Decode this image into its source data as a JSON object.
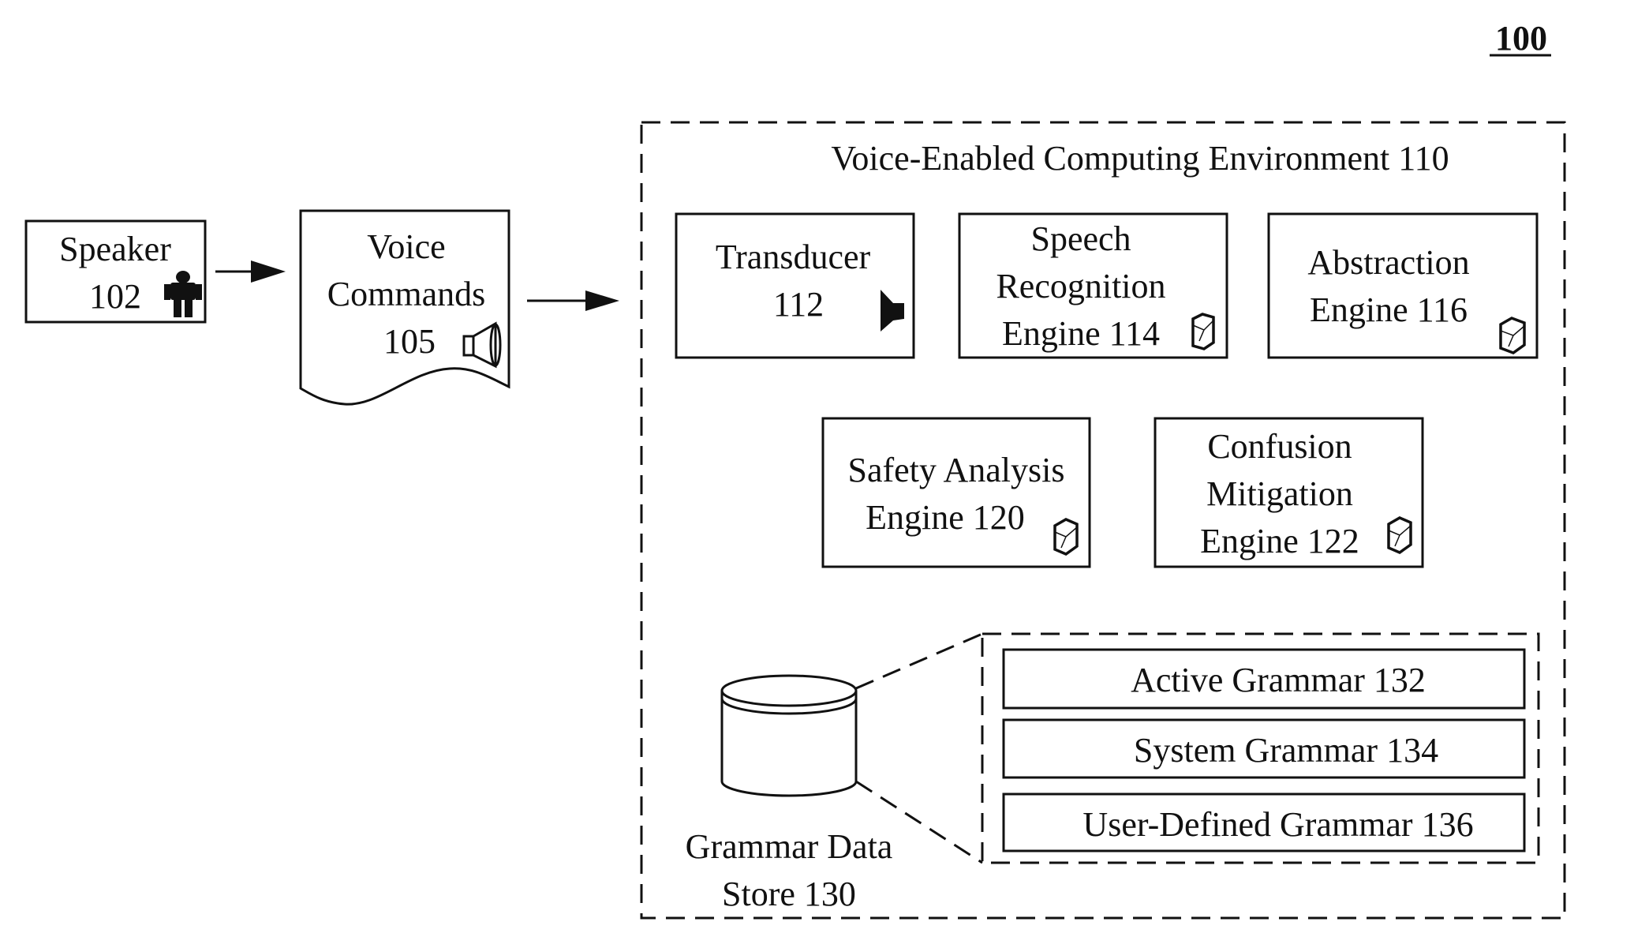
{
  "figure": {
    "number": "100",
    "environment_title": "Voice-Enabled Computing Environment 110"
  },
  "external": {
    "speaker": {
      "lines": [
        "Speaker",
        "102"
      ],
      "icon": "person-icon"
    },
    "voice_commands": {
      "lines": [
        "Voice",
        "Commands",
        "105"
      ],
      "icon": "loudspeaker-icon"
    }
  },
  "components": {
    "transducer": {
      "lines": [
        "Transducer",
        "112"
      ],
      "icon": "speaker-filled-icon"
    },
    "speech_recognition": {
      "lines": [
        "Speech",
        "Recognition",
        "Engine 114"
      ],
      "icon": "engine-cube-icon"
    },
    "abstraction": {
      "lines": [
        "Abstraction",
        "Engine 116"
      ],
      "icon": "engine-cube-icon"
    },
    "safety_analysis": {
      "lines": [
        "Safety Analysis",
        "Engine 120"
      ],
      "icon": "engine-cube-icon"
    },
    "confusion_mitigation": {
      "lines": [
        "Confusion",
        "Mitigation",
        "Engine 122"
      ],
      "icon": "engine-cube-icon"
    }
  },
  "data_store": {
    "lines": [
      "Grammar Data",
      "Store 130"
    ],
    "icon": "database-cylinder-icon",
    "grammars": [
      {
        "label": "Active Grammar 132"
      },
      {
        "label": "System Grammar 134"
      },
      {
        "label": "User-Defined Grammar 136"
      }
    ]
  },
  "colors": {
    "ink": "#111111",
    "background": "#ffffff"
  }
}
